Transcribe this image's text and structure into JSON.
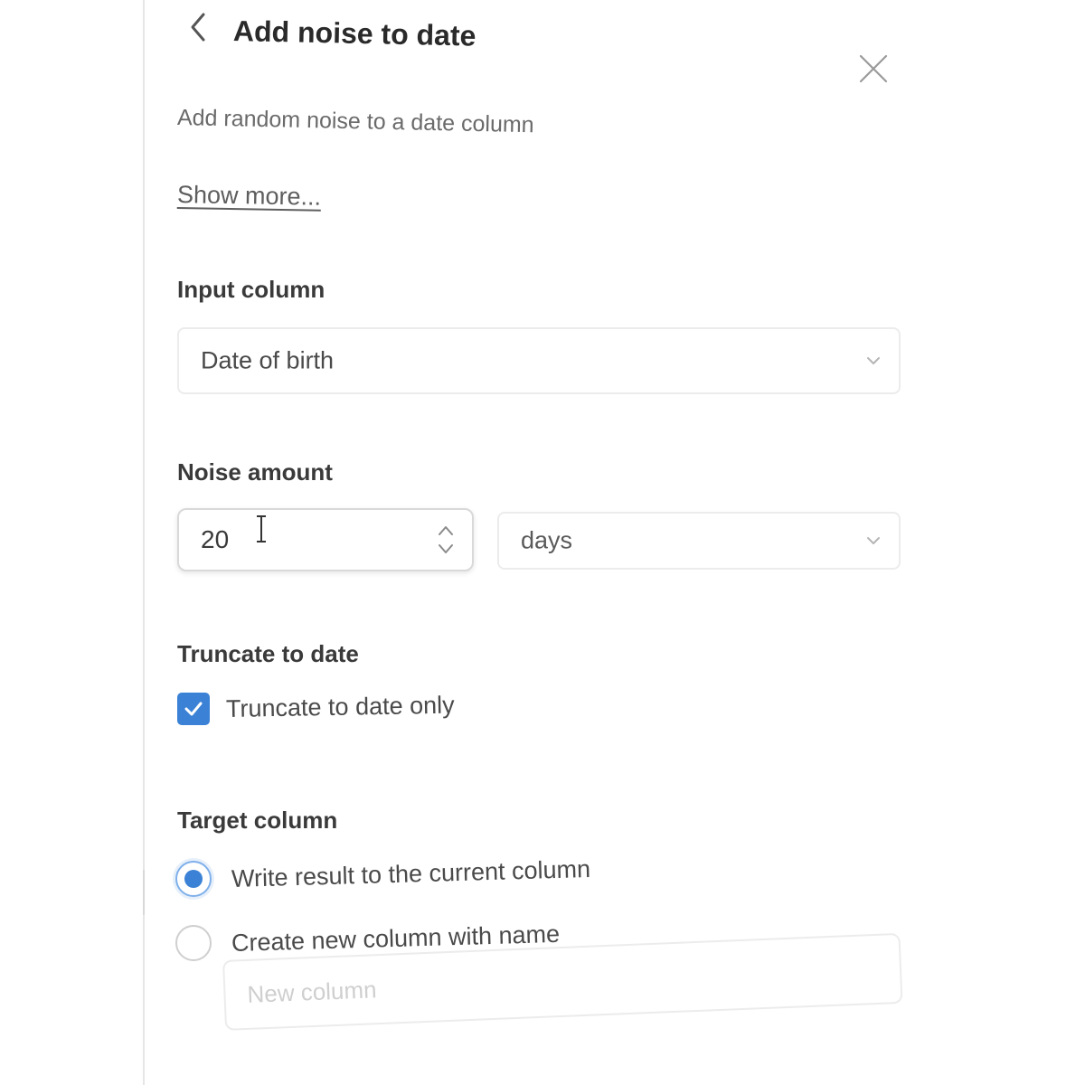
{
  "header": {
    "title": "Add noise to date",
    "back_icon": "chevron-left-icon",
    "close_icon": "close-icon"
  },
  "description": "Add random noise to a date column",
  "show_more_label": "Show more...",
  "input_column": {
    "label": "Input column",
    "selected_value": "Date of birth"
  },
  "noise_amount": {
    "label": "Noise amount",
    "value": "20",
    "unit_selected": "days"
  },
  "truncate": {
    "label": "Truncate to date",
    "checkbox_label": "Truncate to date only",
    "checked": true
  },
  "target_column": {
    "label": "Target column",
    "options": [
      {
        "label": "Write result to the current column",
        "selected": true
      },
      {
        "label": "Create new column with name",
        "selected": false
      }
    ],
    "new_column_placeholder": "New column"
  },
  "colors": {
    "accent": "#3b82d6",
    "title_text": "#2a2a2a",
    "muted_text": "#6a6a6a",
    "border": "#ececec"
  }
}
